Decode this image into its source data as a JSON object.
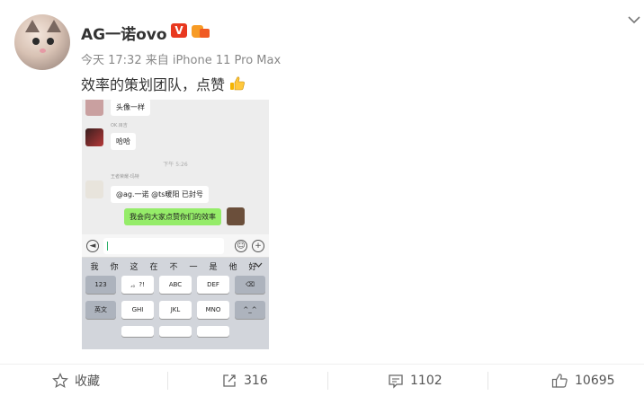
{
  "post": {
    "user_name": "AG一诺ovo",
    "verified_badge": "V",
    "meta": "今天 17:32 来自 iPhone 11 Pro Max",
    "text": "效率的策划团队，点赞"
  },
  "screenshot": {
    "msg1": "头像一样",
    "sender2": "OK.目吉",
    "msg2": "哈哈",
    "time": "下午 5:26",
    "sender3": "王者荣耀-玛特",
    "msg3": "@ag.一诺 @ts暖阳 已封号",
    "msg4": "我会向大家点赞你们的效率",
    "candidates": [
      "我",
      "你",
      "这",
      "在",
      "不",
      "一",
      "是",
      "他",
      "好"
    ],
    "keys": {
      "k123": "123",
      "punct": ",。?!",
      "abc": "ABC",
      "def": "DEF",
      "lang": "英文",
      "ghi": "GHI",
      "jkl": "JKL",
      "mno": "MNO",
      "emoji": "^_^"
    }
  },
  "actions": {
    "favorite": "收藏",
    "repost_count": "316",
    "comment_count": "1102",
    "like_count": "10695"
  },
  "colors": {
    "accent_green": "#95ec69",
    "verified_red": "#e8381f"
  }
}
